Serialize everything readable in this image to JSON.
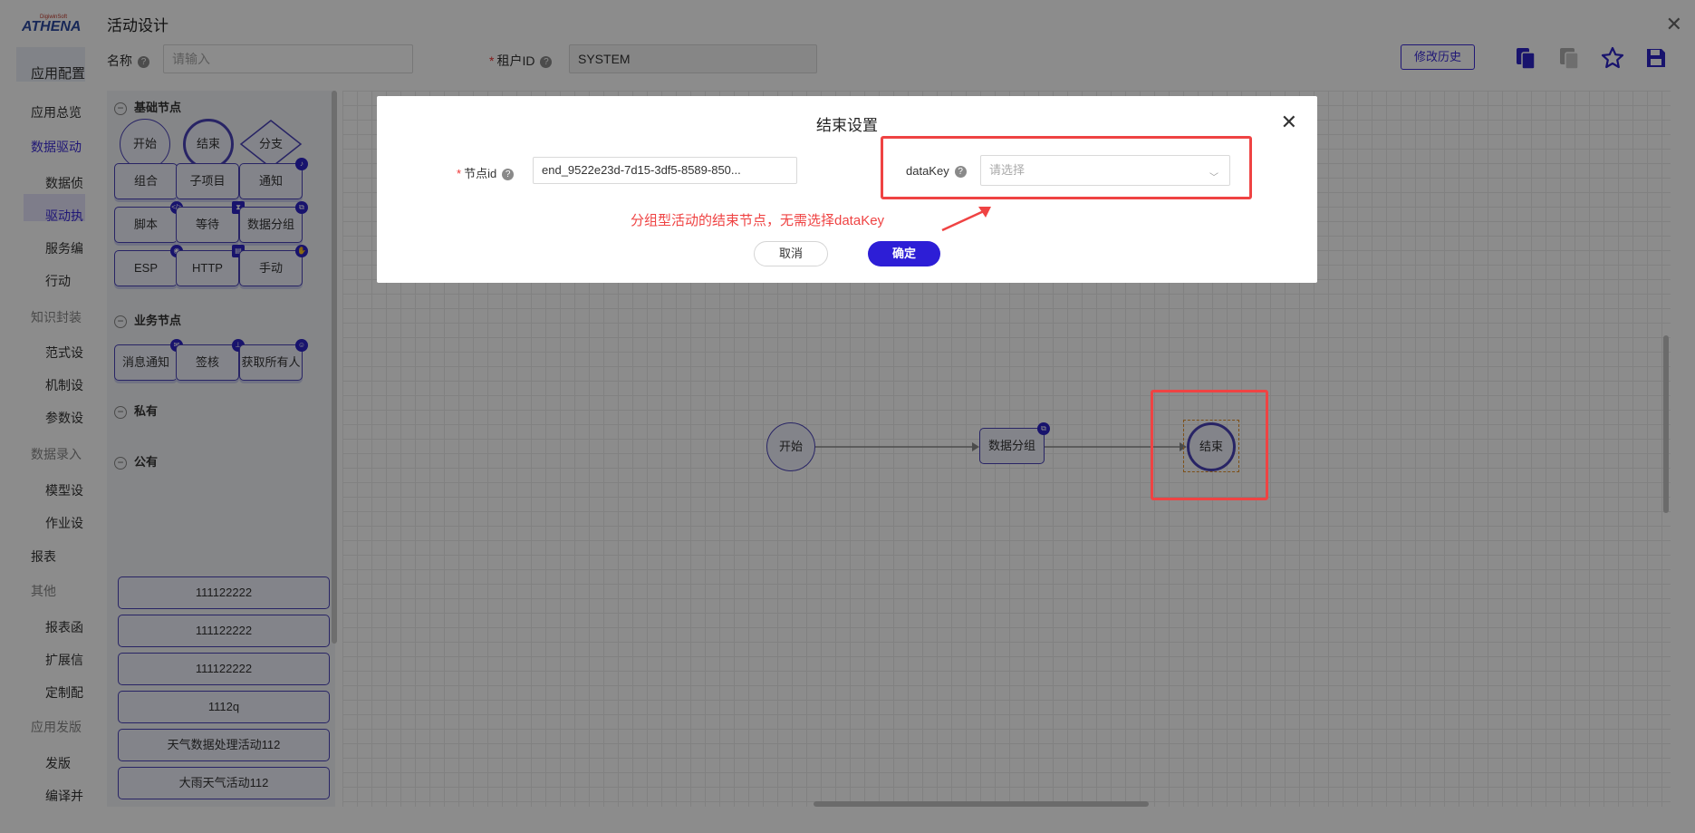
{
  "nav": {
    "items": [
      {
        "label": "应用配置",
        "type": "top"
      },
      {
        "label": "应用总览",
        "type": "item"
      },
      {
        "label": "数据驱动",
        "type": "active"
      },
      {
        "label": "数据侦",
        "type": "sub"
      },
      {
        "label": "驱动执",
        "type": "subactive"
      },
      {
        "label": "服务编",
        "type": "sub"
      },
      {
        "label": "行动",
        "type": "sub"
      },
      {
        "label": "知识封装",
        "type": "group"
      },
      {
        "label": "范式设",
        "type": "sub"
      },
      {
        "label": "机制设",
        "type": "sub"
      },
      {
        "label": "参数设",
        "type": "sub"
      },
      {
        "label": "数据录入",
        "type": "group"
      },
      {
        "label": "模型设",
        "type": "sub"
      },
      {
        "label": "作业设",
        "type": "sub"
      },
      {
        "label": "报表",
        "type": "item"
      },
      {
        "label": "其他",
        "type": "group"
      },
      {
        "label": "报表函",
        "type": "sub"
      },
      {
        "label": "扩展信",
        "type": "sub"
      },
      {
        "label": "定制配",
        "type": "sub"
      },
      {
        "label": "应用发版",
        "type": "group"
      },
      {
        "label": "发版",
        "type": "sub"
      },
      {
        "label": "编译并",
        "type": "sub"
      }
    ]
  },
  "editor": {
    "title": "活动设计",
    "name_label": "名称",
    "name_placeholder": "请输入",
    "tenant_label": "租户ID",
    "tenant_value": "SYSTEM",
    "history_button": "修改历史",
    "icons": [
      "copy-icon",
      "paste-icon",
      "star-icon",
      "save-icon"
    ]
  },
  "palette": {
    "basic_title": "基础节点",
    "basic_nodes": [
      "开始",
      "结束",
      "分支",
      "组合",
      "子项目",
      "通知",
      "脚本",
      "等待",
      "数据分组",
      "ESP",
      "HTTP",
      "手动"
    ],
    "business_title": "业务节点",
    "business_nodes": [
      "消息通知",
      "签核",
      "获取所有人"
    ],
    "private_title": "私有",
    "public_title": "公有",
    "public_nodes": [
      "111122222",
      "111122222",
      "111122222",
      "1112q",
      "天气数据处理活动112",
      "大雨天气活动112"
    ]
  },
  "canvas": {
    "nodes": [
      "开始",
      "数据分组",
      "结束"
    ]
  },
  "modal": {
    "title": "结束设置",
    "node_id_label": "节点id",
    "node_id_value": "end_9522e23d-7d15-3df5-8589-850...",
    "datakey_label": "dataKey",
    "datakey_placeholder": "请选择",
    "annotation": "分组型活动的结束节点，无需选择dataKey",
    "cancel": "取消",
    "confirm": "确定"
  },
  "colors": {
    "primary": "#2d1ed6",
    "node_border": "#4a43b8",
    "annotation": "#ef4343",
    "selection": "#e3932c"
  }
}
